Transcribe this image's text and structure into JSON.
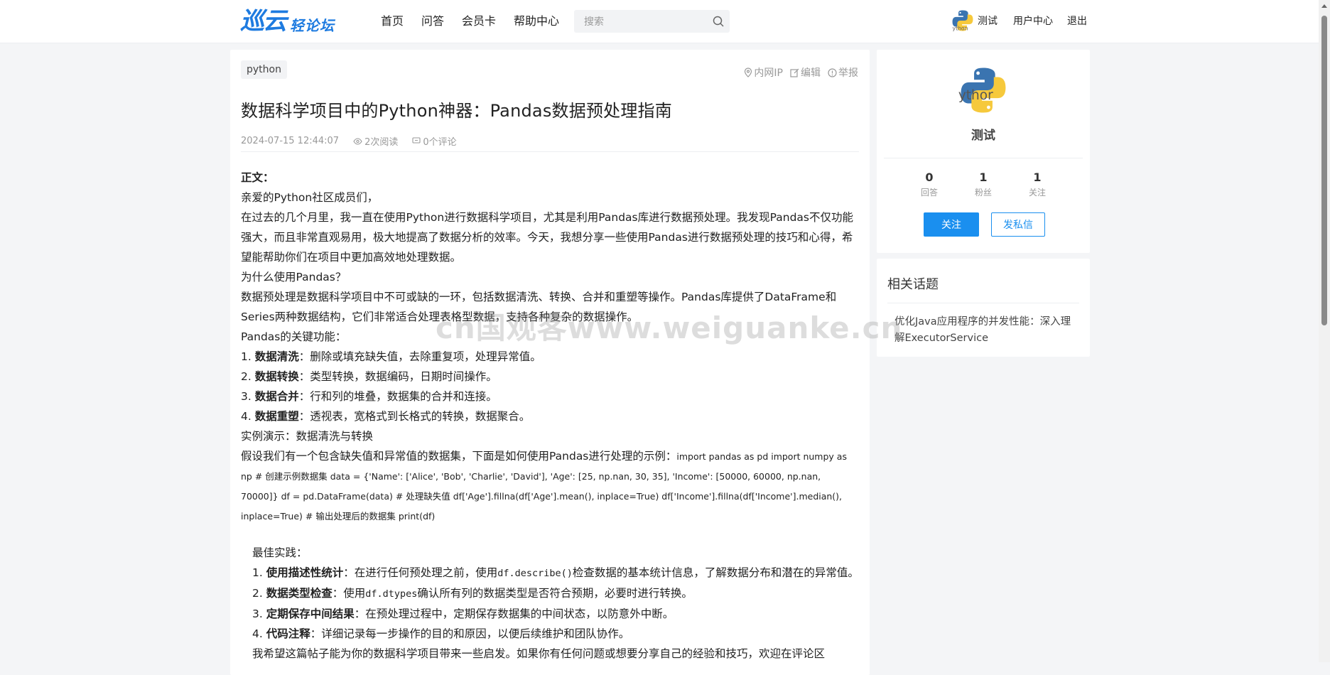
{
  "header": {
    "logo_main": "巡云",
    "logo_sub": "轻论坛",
    "nav": [
      "首页",
      "问答",
      "会员卡",
      "帮助中心"
    ],
    "search_placeholder": "搜索",
    "username": "测试",
    "user_center": "用户中心",
    "logout": "退出"
  },
  "article": {
    "tag": "python",
    "actions": {
      "ip": "内网IP",
      "edit": "编辑",
      "report": "举报"
    },
    "title": "数据科学项目中的Python神器：Pandas数据预处理指南",
    "date": "2024-07-15 12:44:07",
    "reads": "2次阅读",
    "comments": "0个评论",
    "body": {
      "heading": "正文：",
      "greeting": "亲爱的Python社区成员们，",
      "intro": "在过去的几个月里，我一直在使用Python进行数据科学项目，尤其是利用Pandas库进行数据预处理。我发现Pandas不仅功能强大，而且非常直观易用，极大地提高了数据分析的效率。今天，我想分享一些使用Pandas进行数据预处理的技巧和心得，希望能帮助你们在项目中更加高效地处理数据。",
      "why_title": "为什么使用Pandas？",
      "why_text": "数据预处理是数据科学项目中不可或缺的一环，包括数据清洗、转换、合并和重塑等操作。Pandas库提供了DataFrame和Series两种数据结构，它们非常适合处理表格型数据，支持各种复杂的数据操作。",
      "features_title": "Pandas的关键功能：",
      "features": [
        {
          "num": "1. ",
          "bold": "数据清洗",
          "text": "：删除或填充缺失值，去除重复项，处理异常值。"
        },
        {
          "num": "2. ",
          "bold": "数据转换",
          "text": "：类型转换，数据编码，日期时间操作。"
        },
        {
          "num": "3. ",
          "bold": "数据合并",
          "text": "：行和列的堆叠，数据集的合并和连接。"
        },
        {
          "num": "4. ",
          "bold": "数据重塑",
          "text": "：透视表，宽格式到长格式的转换，数据聚合。"
        }
      ],
      "demo_title": "实例演示：数据清洗与转换",
      "demo_intro": "假设我们有一个包含缺失值和异常值的数据集，下面是如何使用Pandas进行处理的示例：",
      "demo_code": "import pandas as pd import numpy as np # 创建示例数据集 data = {'Name': ['Alice', 'Bob', 'Charlie', 'David'], 'Age': [25, np.nan, 30, 35], 'Income': [50000, 60000, np.nan, 70000]} df = pd.DataFrame(data) # 处理缺失值 df['Age'].fillna(df['Age'].mean(), inplace=True) df['Income'].fillna(df['Income'].median(), inplace=True) # 输出处理后的数据集 print(df)",
      "best_title": "最佳实践：",
      "best": [
        {
          "num": "1. ",
          "bold": "使用描述性统计",
          "pre": "：在进行任何预处理之前，使用",
          "code": "df.describe()",
          "post": "检查数据的基本统计信息，了解数据分布和潜在的异常值。"
        },
        {
          "num": "2. ",
          "bold": "数据类型检查",
          "pre": "：使用",
          "code": "df.dtypes",
          "post": "确认所有列的数据类型是否符合预期，必要时进行转换。"
        },
        {
          "num": "3. ",
          "bold": "定期保存中间结果",
          "pre": "：在预处理过程中，定期保存数据集的中间状态，以防意外中断。",
          "code": "",
          "post": ""
        },
        {
          "num": "4. ",
          "bold": "代码注释",
          "pre": "：详细记录每一步操作的目的和原因，以便后续维护和团队协作。",
          "code": "",
          "post": ""
        }
      ],
      "closing": "我希望这篇帖子能为你的数据科学项目带来一些启发。如果你有任何问题或想要分享自己的经验和技巧，欢迎在评论区"
    }
  },
  "profile": {
    "name": "测试",
    "stats": [
      {
        "value": "0",
        "label": "回答"
      },
      {
        "value": "1",
        "label": "粉丝"
      },
      {
        "value": "1",
        "label": "关注"
      }
    ],
    "follow_label": "关注",
    "message_label": "发私信"
  },
  "related": {
    "title": "相关话题",
    "items": [
      "优化Java应用程序的并发性能：深入理解ExecutorService"
    ]
  },
  "watermark": "cn国观客www.weiguanke.cn",
  "colors": {
    "accent": "#1a8fef",
    "logo": "#1e7be0",
    "page_bg": "#f4f5f7"
  }
}
